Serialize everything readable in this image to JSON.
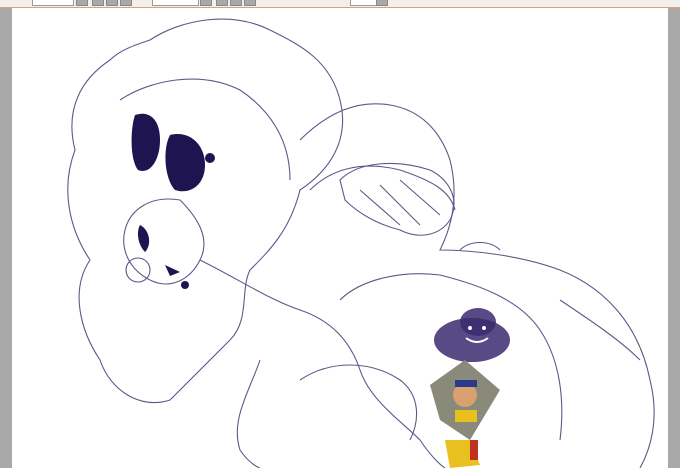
{
  "toolbar": {
    "zoom_field": "",
    "size_field": "",
    "scale_field": ""
  },
  "canvas": {
    "line_color": "#5a5a8a",
    "ink_color": "#1e1450",
    "smoke_color": "#3a2a70"
  }
}
